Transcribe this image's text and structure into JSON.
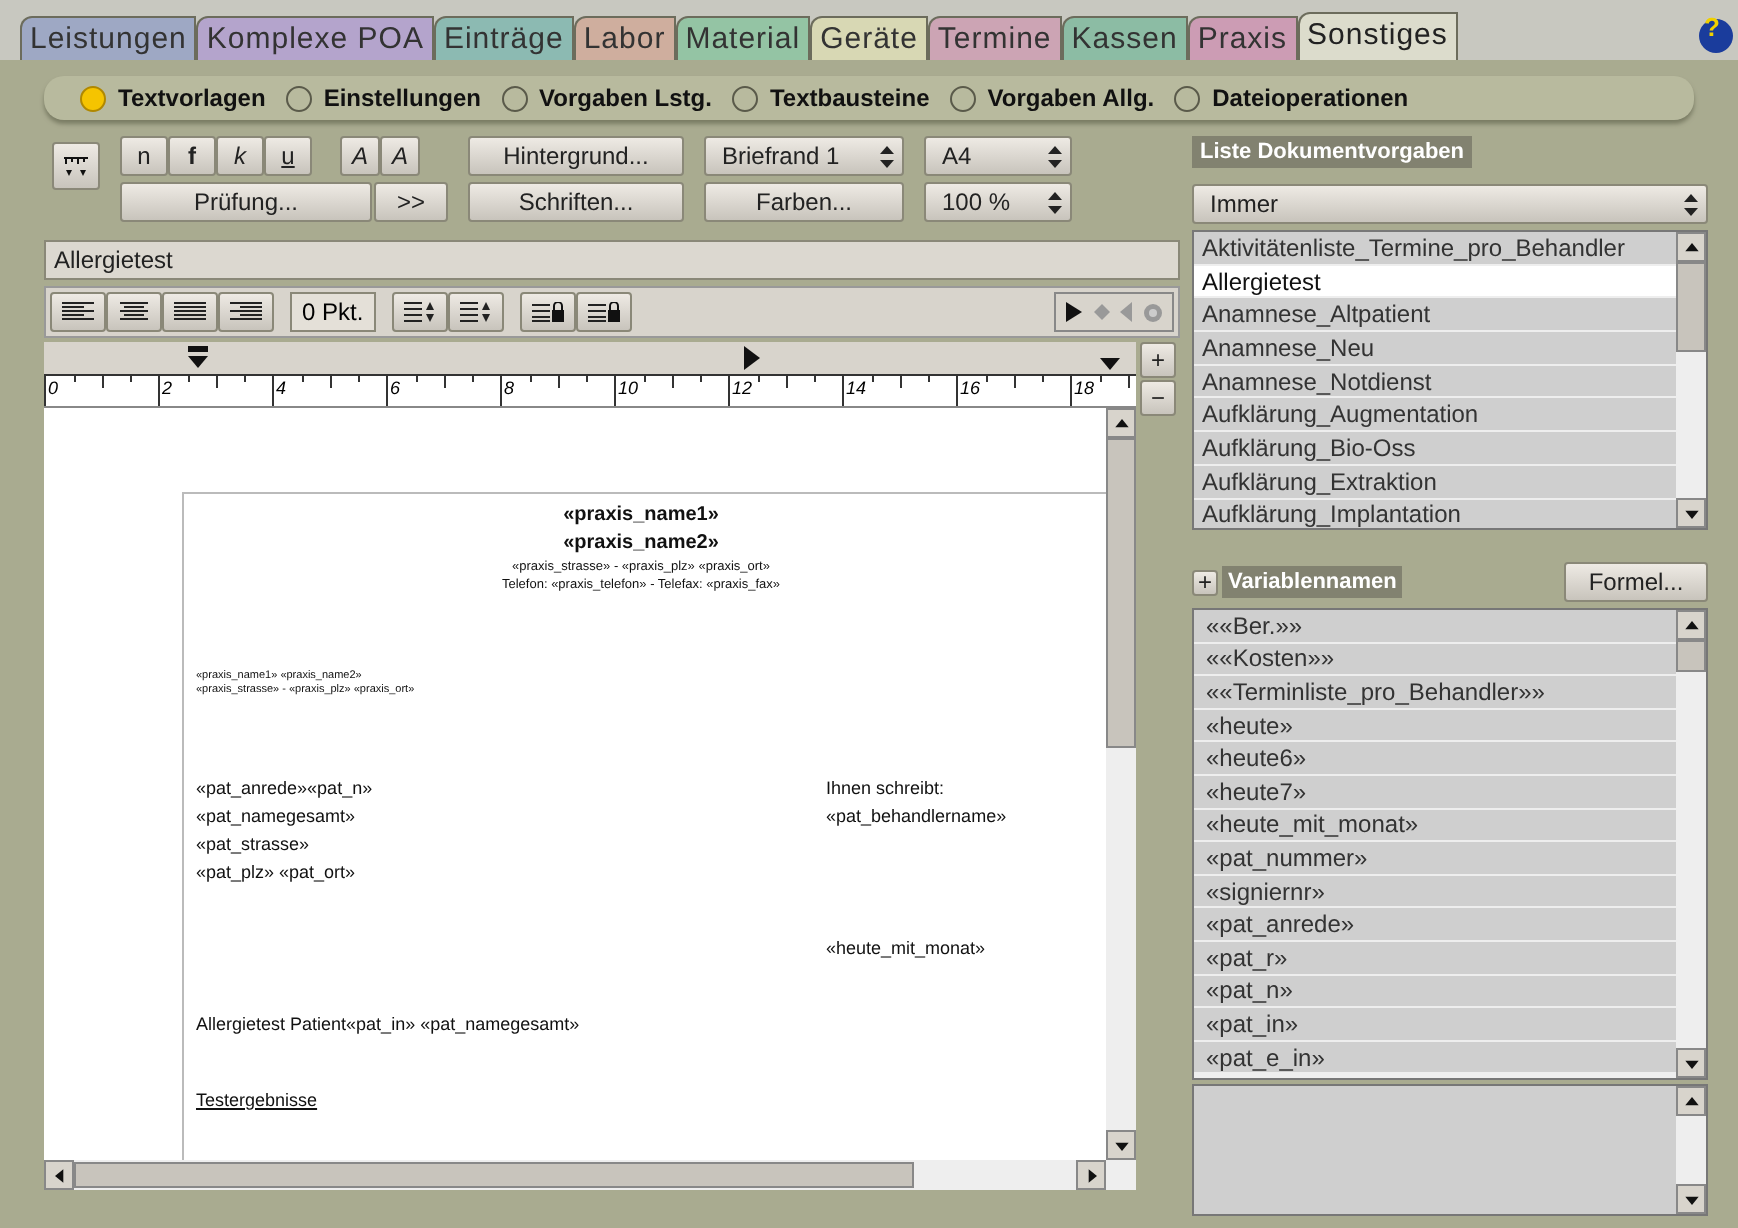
{
  "help": "?",
  "tabs": [
    {
      "label": "Leistungen",
      "selected": false,
      "color": "#9ea8c4"
    },
    {
      "label": "Komplexe POA",
      "selected": false,
      "color": "#b4a4cc"
    },
    {
      "label": "Einträge",
      "selected": false,
      "color": "#8cbab2"
    },
    {
      "label": "Labor",
      "selected": false,
      "color": "#cfae9e"
    },
    {
      "label": "Material",
      "selected": false,
      "color": "#94c4a4"
    },
    {
      "label": "Geräte",
      "selected": false,
      "color": "#d8d8b4"
    },
    {
      "label": "Termine",
      "selected": false,
      "color": "#cca4b4"
    },
    {
      "label": "Kassen",
      "selected": false,
      "color": "#8cbca4"
    },
    {
      "label": "Praxis",
      "selected": false,
      "color": "#cc9cb4"
    },
    {
      "label": "Sonstiges",
      "selected": true,
      "color": "#dcdccc"
    }
  ],
  "modes": [
    {
      "label": "Textvorlagen",
      "selected": true
    },
    {
      "label": "Einstellungen",
      "selected": false
    },
    {
      "label": "Vorgaben Lstg.",
      "selected": false
    },
    {
      "label": "Textbausteine",
      "selected": false
    },
    {
      "label": "Vorgaben Allg.",
      "selected": false
    },
    {
      "label": "Dateioperationen",
      "selected": false
    }
  ],
  "toolbar": {
    "style_buttons": [
      "n",
      "f",
      "k",
      "u"
    ],
    "font_buttons": [
      "A",
      "A"
    ],
    "check_button": "Prüfung...",
    "more_button": ">>",
    "background_button": "Hintergrund...",
    "fonts_button": "Schriften...",
    "margin_select": "Briefrand 1",
    "colors_button": "Farben...",
    "paper_select": "A4",
    "zoom_select": "100 %"
  },
  "document_name": "Allergietest",
  "format_bar": {
    "spacing": "0 Pkt."
  },
  "ruler": {
    "labels": [
      "0",
      "2",
      "4",
      "6",
      "8",
      "10",
      "12",
      "14",
      "16",
      "18"
    ]
  },
  "zoom_buttons": [
    "+",
    "−"
  ],
  "document": [
    {
      "kind": "title",
      "text": "«praxis_name1»"
    },
    {
      "kind": "title",
      "text": "«praxis_name2»"
    },
    {
      "kind": "small",
      "text": "«praxis_strasse» - «praxis_plz» «praxis_ort»"
    },
    {
      "kind": "small",
      "text": "Telefon: «praxis_telefon» - Telefax: «praxis_fax»"
    },
    {
      "kind": "gap"
    },
    {
      "kind": "tiny",
      "text": "«praxis_name1» «praxis_name2»"
    },
    {
      "kind": "tiny",
      "text": "«praxis_strasse» - «praxis_plz» «praxis_ort»"
    },
    {
      "kind": "gap"
    },
    {
      "kind": "two",
      "text": "«pat_anrede»«pat_n»",
      "right": "Ihnen schreibt:"
    },
    {
      "kind": "two",
      "text": "«pat_namegesamt»",
      "right": "«pat_behandlername»"
    },
    {
      "kind": "body",
      "text": "«pat_strasse»"
    },
    {
      "kind": "body",
      "text": "«pat_plz» «pat_ort»"
    },
    {
      "kind": "space"
    },
    {
      "kind": "right",
      "text": "«heute_mit_monat»"
    },
    {
      "kind": "space"
    },
    {
      "kind": "body",
      "text": "Allergietest Patient«pat_in» «pat_namegesamt»"
    },
    {
      "kind": "space"
    },
    {
      "kind": "underline",
      "text": "Testergebnisse"
    }
  ],
  "templates": {
    "title": "Liste Dokumentvorgaben",
    "filter": "Immer",
    "items": [
      {
        "label": "Aktivitätenliste_Termine_pro_Behandler",
        "selected": false
      },
      {
        "label": "Allergietest",
        "selected": true
      },
      {
        "label": "Anamnese_Altpatient",
        "selected": false
      },
      {
        "label": "Anamnese_Neu",
        "selected": false
      },
      {
        "label": "Anamnese_Notdienst",
        "selected": false
      },
      {
        "label": "Aufklärung_Augmentation",
        "selected": false
      },
      {
        "label": "Aufklärung_Bio-Oss",
        "selected": false
      },
      {
        "label": "Aufklärung_Extraktion",
        "selected": false
      },
      {
        "label": "Aufklärung_Implantation",
        "selected": false
      }
    ]
  },
  "variables": {
    "expand": "+",
    "title": "Variablennamen",
    "formula_button": "Formel...",
    "items": [
      "««Ber.»»",
      "««Kosten»»",
      "««Terminliste_pro_Behandler»»",
      "«heute»",
      "«heute6»",
      "«heute7»",
      "«heute_mit_monat»",
      "«pat_nummer»",
      "«signiernr»",
      "«pat_anrede»",
      "«pat_r»",
      "«pat_n»",
      "«pat_in»",
      "«pat_e_in»"
    ]
  }
}
